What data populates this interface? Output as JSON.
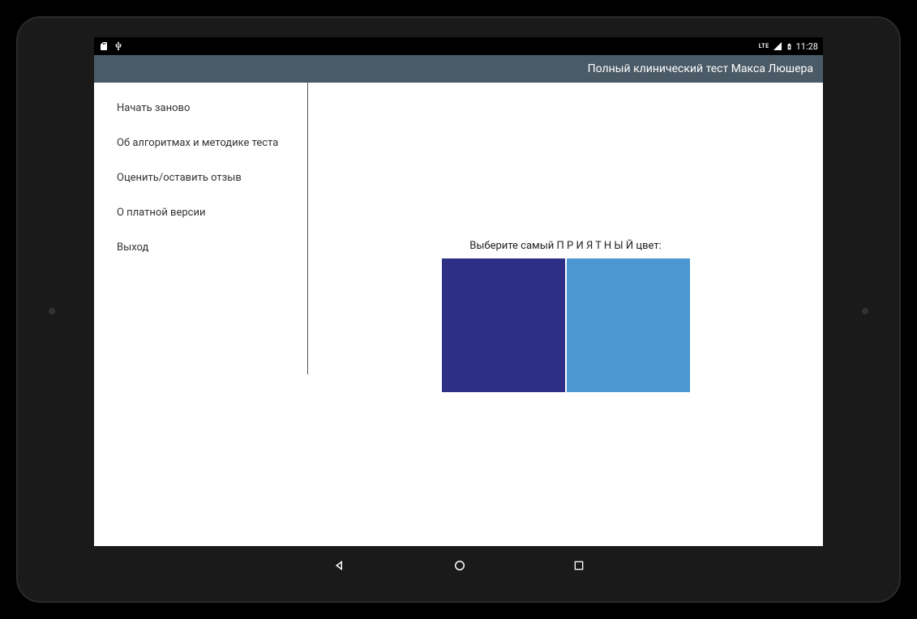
{
  "status_bar": {
    "time": "11:28",
    "lte": "LTE"
  },
  "app": {
    "title": "Полный клинический тест Макса Люшера"
  },
  "sidebar": {
    "items": [
      {
        "label": "Начать заново"
      },
      {
        "label": "Об алгоритмах и методике теста"
      },
      {
        "label": "Оценить/оставить отзыв"
      },
      {
        "label": "О платной версии"
      },
      {
        "label": "Выход"
      }
    ]
  },
  "main": {
    "prompt": "Выберите самый  П Р И Я Т Н Ы Й  цвет:",
    "colors": {
      "left": "#2d2e86",
      "right": "#4a97d3"
    }
  }
}
